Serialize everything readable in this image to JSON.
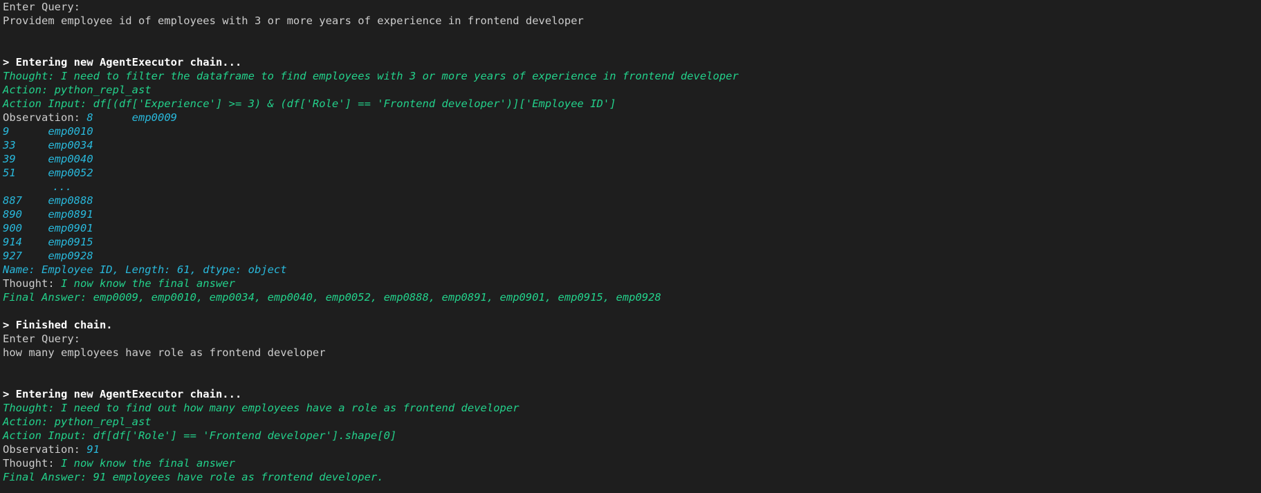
{
  "block1": {
    "enter_query": "Enter Query:",
    "query": "Providem employee id of employees with 3 or more years of experience in frontend developer",
    "entering": "> Entering new AgentExecutor chain...",
    "thought": "Thought: I need to filter the dataframe to find employees with 3 or more years of experience in frontend developer",
    "action": "Action: python_repl_ast",
    "action_input": "Action Input: df[(df['Experience'] >= 3) & (df['Role'] == 'Frontend developer')]['Employee ID']",
    "observation_label": "Observation: ",
    "observation_rows": [
      {
        "index": "8",
        "value": "emp0009"
      },
      {
        "index": "9",
        "value": "emp0010"
      },
      {
        "index": "33",
        "value": "emp0034"
      },
      {
        "index": "39",
        "value": "emp0040"
      },
      {
        "index": "51",
        "value": "emp0052"
      },
      {
        "index": "",
        "value": "..."
      },
      {
        "index": "887",
        "value": "emp0888"
      },
      {
        "index": "890",
        "value": "emp0891"
      },
      {
        "index": "900",
        "value": "emp0901"
      },
      {
        "index": "914",
        "value": "emp0915"
      },
      {
        "index": "927",
        "value": "emp0928"
      }
    ],
    "series_info": "Name: Employee ID, Length: 61, dtype: object",
    "thought2_label": "Thought: ",
    "thought2_text": "I now know the final answer",
    "final_answer": "Final Answer: emp0009, emp0010, emp0034, emp0040, emp0052, emp0888, emp0891, emp0901, emp0915, emp0928",
    "finished": "> Finished chain."
  },
  "block2": {
    "enter_query": "Enter Query:",
    "query": "how many employees have role as frontend developer",
    "entering": "> Entering new AgentExecutor chain...",
    "thought": "Thought: I need to find out how many employees have a role as frontend developer",
    "action": "Action: python_repl_ast",
    "action_input": "Action Input: df[df['Role'] == 'Frontend developer'].shape[0]",
    "observation_label": "Observation: ",
    "observation_value": "91",
    "thought2_label": "Thought: ",
    "thought2_text": "I now know the final answer",
    "final_answer": "Final Answer: 91 employees have role as frontend developer."
  },
  "colors": {
    "background": "#1e1e1e",
    "default_text": "#cccccc",
    "bold_text": "#ffffff",
    "green": "#23d18b",
    "cyan": "#29b8db"
  }
}
